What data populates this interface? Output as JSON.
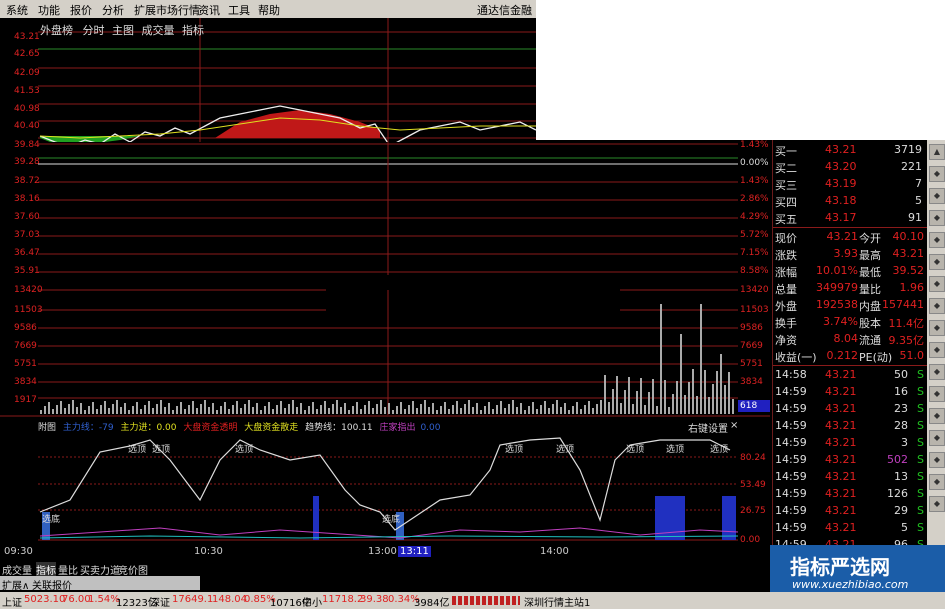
{
  "menu": {
    "items": [
      "系统",
      "功能",
      "报价",
      "分析",
      "扩展市场行情",
      "资讯",
      "工具",
      "帮助"
    ],
    "brand": "通达信金融"
  },
  "top_tabs": [
    "外盘榜",
    "分时",
    "主图",
    "成交量",
    "指标"
  ],
  "top_axis": [
    "43.21",
    "42.65",
    "42.09",
    "41.53",
    "40.98",
    "40.40",
    "39.84"
  ],
  "price_axis_left": [
    "39.28",
    "38.72",
    "38.16",
    "37.60",
    "37.03",
    "36.47",
    "35.91"
  ],
  "price_axis_right": [
    "1.43%",
    "0.00%",
    "1.43%",
    "2.86%",
    "4.29%",
    "5.72%",
    "7.15%",
    "8.58%"
  ],
  "volume_axis_left": [
    "13420",
    "11503",
    "9586",
    "7669",
    "5751",
    "3834",
    "1917"
  ],
  "volume_axis_right": [
    "13420",
    "11503",
    "9586",
    "7669",
    "5751",
    "3834",
    "1917"
  ],
  "volume_box": "618",
  "top_pct": "1.43%",
  "indicator": {
    "header_items": [
      "附图",
      "主力线：-79",
      "主力进：0.00",
      "大盘资金透明",
      "大盘资金散走",
      "趋势线：100.11",
      "庄家指出",
      "0.00"
    ],
    "settings_label": "右键设置",
    "axis": [
      "80.24",
      "53.49",
      "26.75",
      "0.00"
    ],
    "signals": [
      "选顶",
      "选顶",
      "选顶",
      "选顶",
      "选顶",
      "选顶",
      "选顶",
      "选底",
      "选底",
      "选顶"
    ]
  },
  "time_axis": [
    "09:30",
    "10:30",
    "13:00",
    "13:11",
    "14:00"
  ],
  "bottom_tabs": [
    "成交量",
    "指标",
    "量比",
    "买卖力道",
    "竞价图"
  ],
  "bottom_tabs2": [
    "扩展∧",
    "关联报价"
  ],
  "quotes": {
    "asks": [
      {
        "label": "买一",
        "price": "43.21",
        "vol": "3719"
      },
      {
        "label": "买二",
        "price": "43.20",
        "vol": "221"
      },
      {
        "label": "买三",
        "price": "43.19",
        "vol": "7"
      },
      {
        "label": "买四",
        "price": "43.18",
        "vol": "5"
      },
      {
        "label": "买五",
        "price": "43.17",
        "vol": "91"
      }
    ],
    "stats": [
      {
        "l1": "现价",
        "v1": "43.21",
        "l2": "今开",
        "v2": "40.10"
      },
      {
        "l1": "涨跌",
        "v1": "3.93",
        "l2": "最高",
        "v2": "43.21"
      },
      {
        "l1": "涨幅",
        "v1": "10.01%",
        "l2": "最低",
        "v2": "39.52"
      },
      {
        "l1": "总量",
        "v1": "349979",
        "l2": "量比",
        "v2": "1.96"
      },
      {
        "l1": "外盘",
        "v1": "192538",
        "l2": "内盘",
        "v2": "157441"
      },
      {
        "l1": "换手",
        "v1": "3.74%",
        "l2": "股本",
        "v2": "11.4亿"
      },
      {
        "l1": "净资",
        "v1": "8.04",
        "l2": "流通",
        "v2": "9.35亿"
      },
      {
        "l1": "收益(一)",
        "v1": "0.212",
        "l2": "PE(动)",
        "v2": "51.0"
      }
    ],
    "ticks": [
      {
        "t": "14:58",
        "p": "43.21",
        "v": "50",
        "s": "S"
      },
      {
        "t": "14:59",
        "p": "43.21",
        "v": "16",
        "s": "S"
      },
      {
        "t": "14:59",
        "p": "43.21",
        "v": "23",
        "s": "S"
      },
      {
        "t": "14:59",
        "p": "43.21",
        "v": "28",
        "s": "S"
      },
      {
        "t": "14:59",
        "p": "43.21",
        "v": "3",
        "s": "S"
      },
      {
        "t": "14:59",
        "p": "43.21",
        "v": "502",
        "s": "S"
      },
      {
        "t": "14:59",
        "p": "43.21",
        "v": "13",
        "s": "S"
      },
      {
        "t": "14:59",
        "p": "43.21",
        "v": "126",
        "s": "S"
      },
      {
        "t": "14:59",
        "p": "43.21",
        "v": "29",
        "s": "S"
      },
      {
        "t": "14:59",
        "p": "43.21",
        "v": "5",
        "s": "S"
      },
      {
        "t": "14:59",
        "p": "43.21",
        "v": "96",
        "s": "S"
      },
      {
        "t": "14:59",
        "p": "43.21",
        "v": "",
        "s": ""
      }
    ]
  },
  "status": {
    "sh_label": "上证",
    "sh_val": "5023.10",
    "sh_chg": "76.00",
    "sh_pct": "1.54%",
    "sh_amt": "12323亿",
    "sz_label": "深证",
    "sz_val": "17649.1",
    "sz_chg": "148.04",
    "sz_pct": "0.85%",
    "sz_amt": "10716亿",
    "zx_label": "中小",
    "zx_val": "11718.2",
    "zx_chg": "39.38",
    "zx_pct": "0.34%",
    "zx_amt": "3984亿",
    "server": "深圳行情主站1"
  },
  "watermark": {
    "title": "指标严选网",
    "url": "www.xuezhibiao.com"
  },
  "colors": {
    "up": "#e02020",
    "down": "#20c020",
    "grid": "#8a1a1a",
    "bg": "#000000"
  }
}
